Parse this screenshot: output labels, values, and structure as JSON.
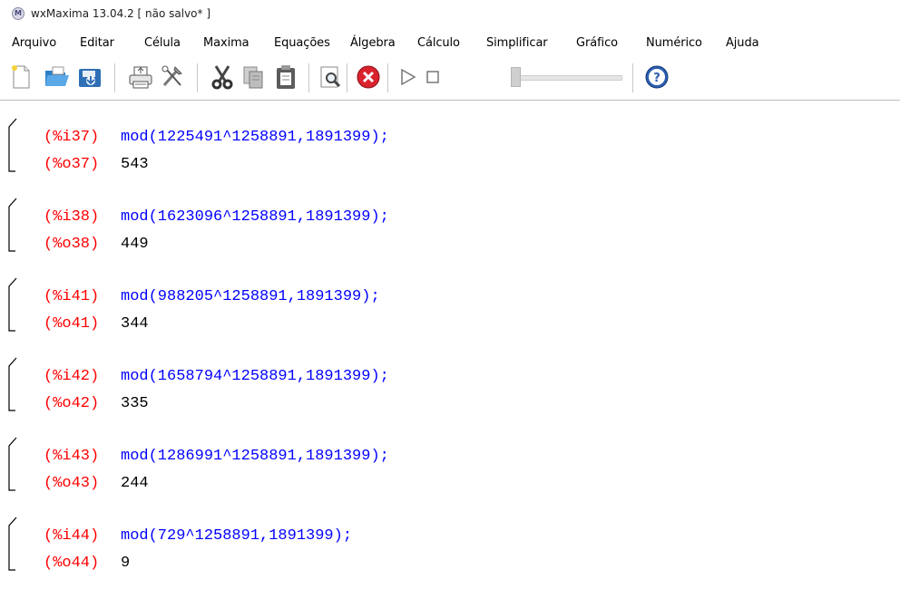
{
  "window": {
    "title": "wxMaxima 13.04.2 [ não salvo* ]",
    "icon": "wxmaxima-logo-icon"
  },
  "menu": [
    {
      "label": "Arquivo"
    },
    {
      "label": "Editar"
    },
    {
      "label": "Célula"
    },
    {
      "label": "Maxima"
    },
    {
      "label": "Equações"
    },
    {
      "label": "Álgebra"
    },
    {
      "label": "Cálculo"
    },
    {
      "label": "Simplificar"
    },
    {
      "label": "Gráfico"
    },
    {
      "label": "Numérico"
    },
    {
      "label": "Ajuda"
    }
  ],
  "toolbar": {
    "buttons": [
      "new-document-icon",
      "open-folder-icon",
      "save-icon",
      "print-icon",
      "preferences-icon",
      "cut-icon",
      "copy-icon",
      "paste-icon",
      "find-icon",
      "interrupt-icon",
      "play-icon",
      "stop-icon",
      "animation-slider",
      "help-icon"
    ],
    "colors": {
      "interrupt": "#d9232e",
      "help": "#2a5db0"
    }
  },
  "cells": [
    {
      "in_label": "(%i37)",
      "input": "mod(1225491^1258891,1891399);",
      "out_label": "(%o37)",
      "output": "543"
    },
    {
      "in_label": "(%i38)",
      "input": "mod(1623096^1258891,1891399);",
      "out_label": "(%o38)",
      "output": "449"
    },
    {
      "in_label": "(%i41)",
      "input": "mod(988205^1258891,1891399);",
      "out_label": "(%o41)",
      "output": "344"
    },
    {
      "in_label": "(%i42)",
      "input": "mod(1658794^1258891,1891399);",
      "out_label": "(%o42)",
      "output": "335"
    },
    {
      "in_label": "(%i43)",
      "input": "mod(1286991^1258891,1891399);",
      "out_label": "(%o43)",
      "output": "244"
    },
    {
      "in_label": "(%i44)",
      "input": "mod(729^1258891,1891399);",
      "out_label": "(%o44)",
      "output": "9"
    }
  ],
  "colors": {
    "input_label": "#ff0000",
    "input_text": "#0000ff",
    "output_text": "#000000"
  }
}
